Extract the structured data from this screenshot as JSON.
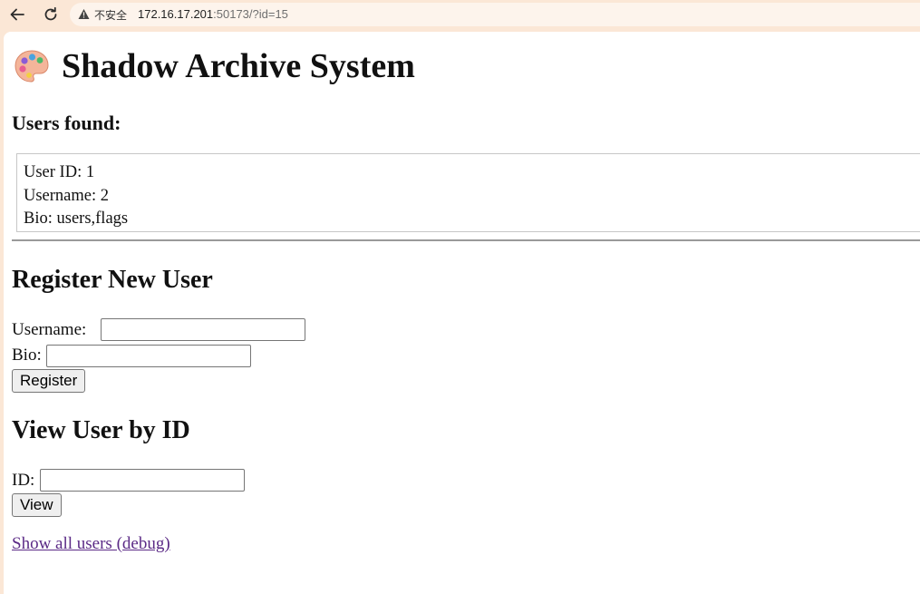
{
  "browser": {
    "security_label": "不安全",
    "url_host": "172.16.17.201",
    "url_rest": ":50173/?id=15"
  },
  "page": {
    "title": "Shadow Archive System",
    "users_found_heading": "Users found:",
    "user_record": {
      "id_line": "User ID: 1",
      "username_line": "Username: 2",
      "bio_line": "Bio: users,flags"
    },
    "register": {
      "heading": "Register New User",
      "username_label": "Username:",
      "username_value": "",
      "bio_label": "Bio:",
      "bio_value": "",
      "button_label": "Register"
    },
    "view": {
      "heading": "View User by ID",
      "id_label": "ID:",
      "id_value": "",
      "button_label": "View"
    },
    "debug_link": "Show all users (debug)"
  },
  "colors": {
    "chrome_bg": "#fbe7d6",
    "link_visited": "#5b2a86",
    "warning_icon": "#444444"
  }
}
